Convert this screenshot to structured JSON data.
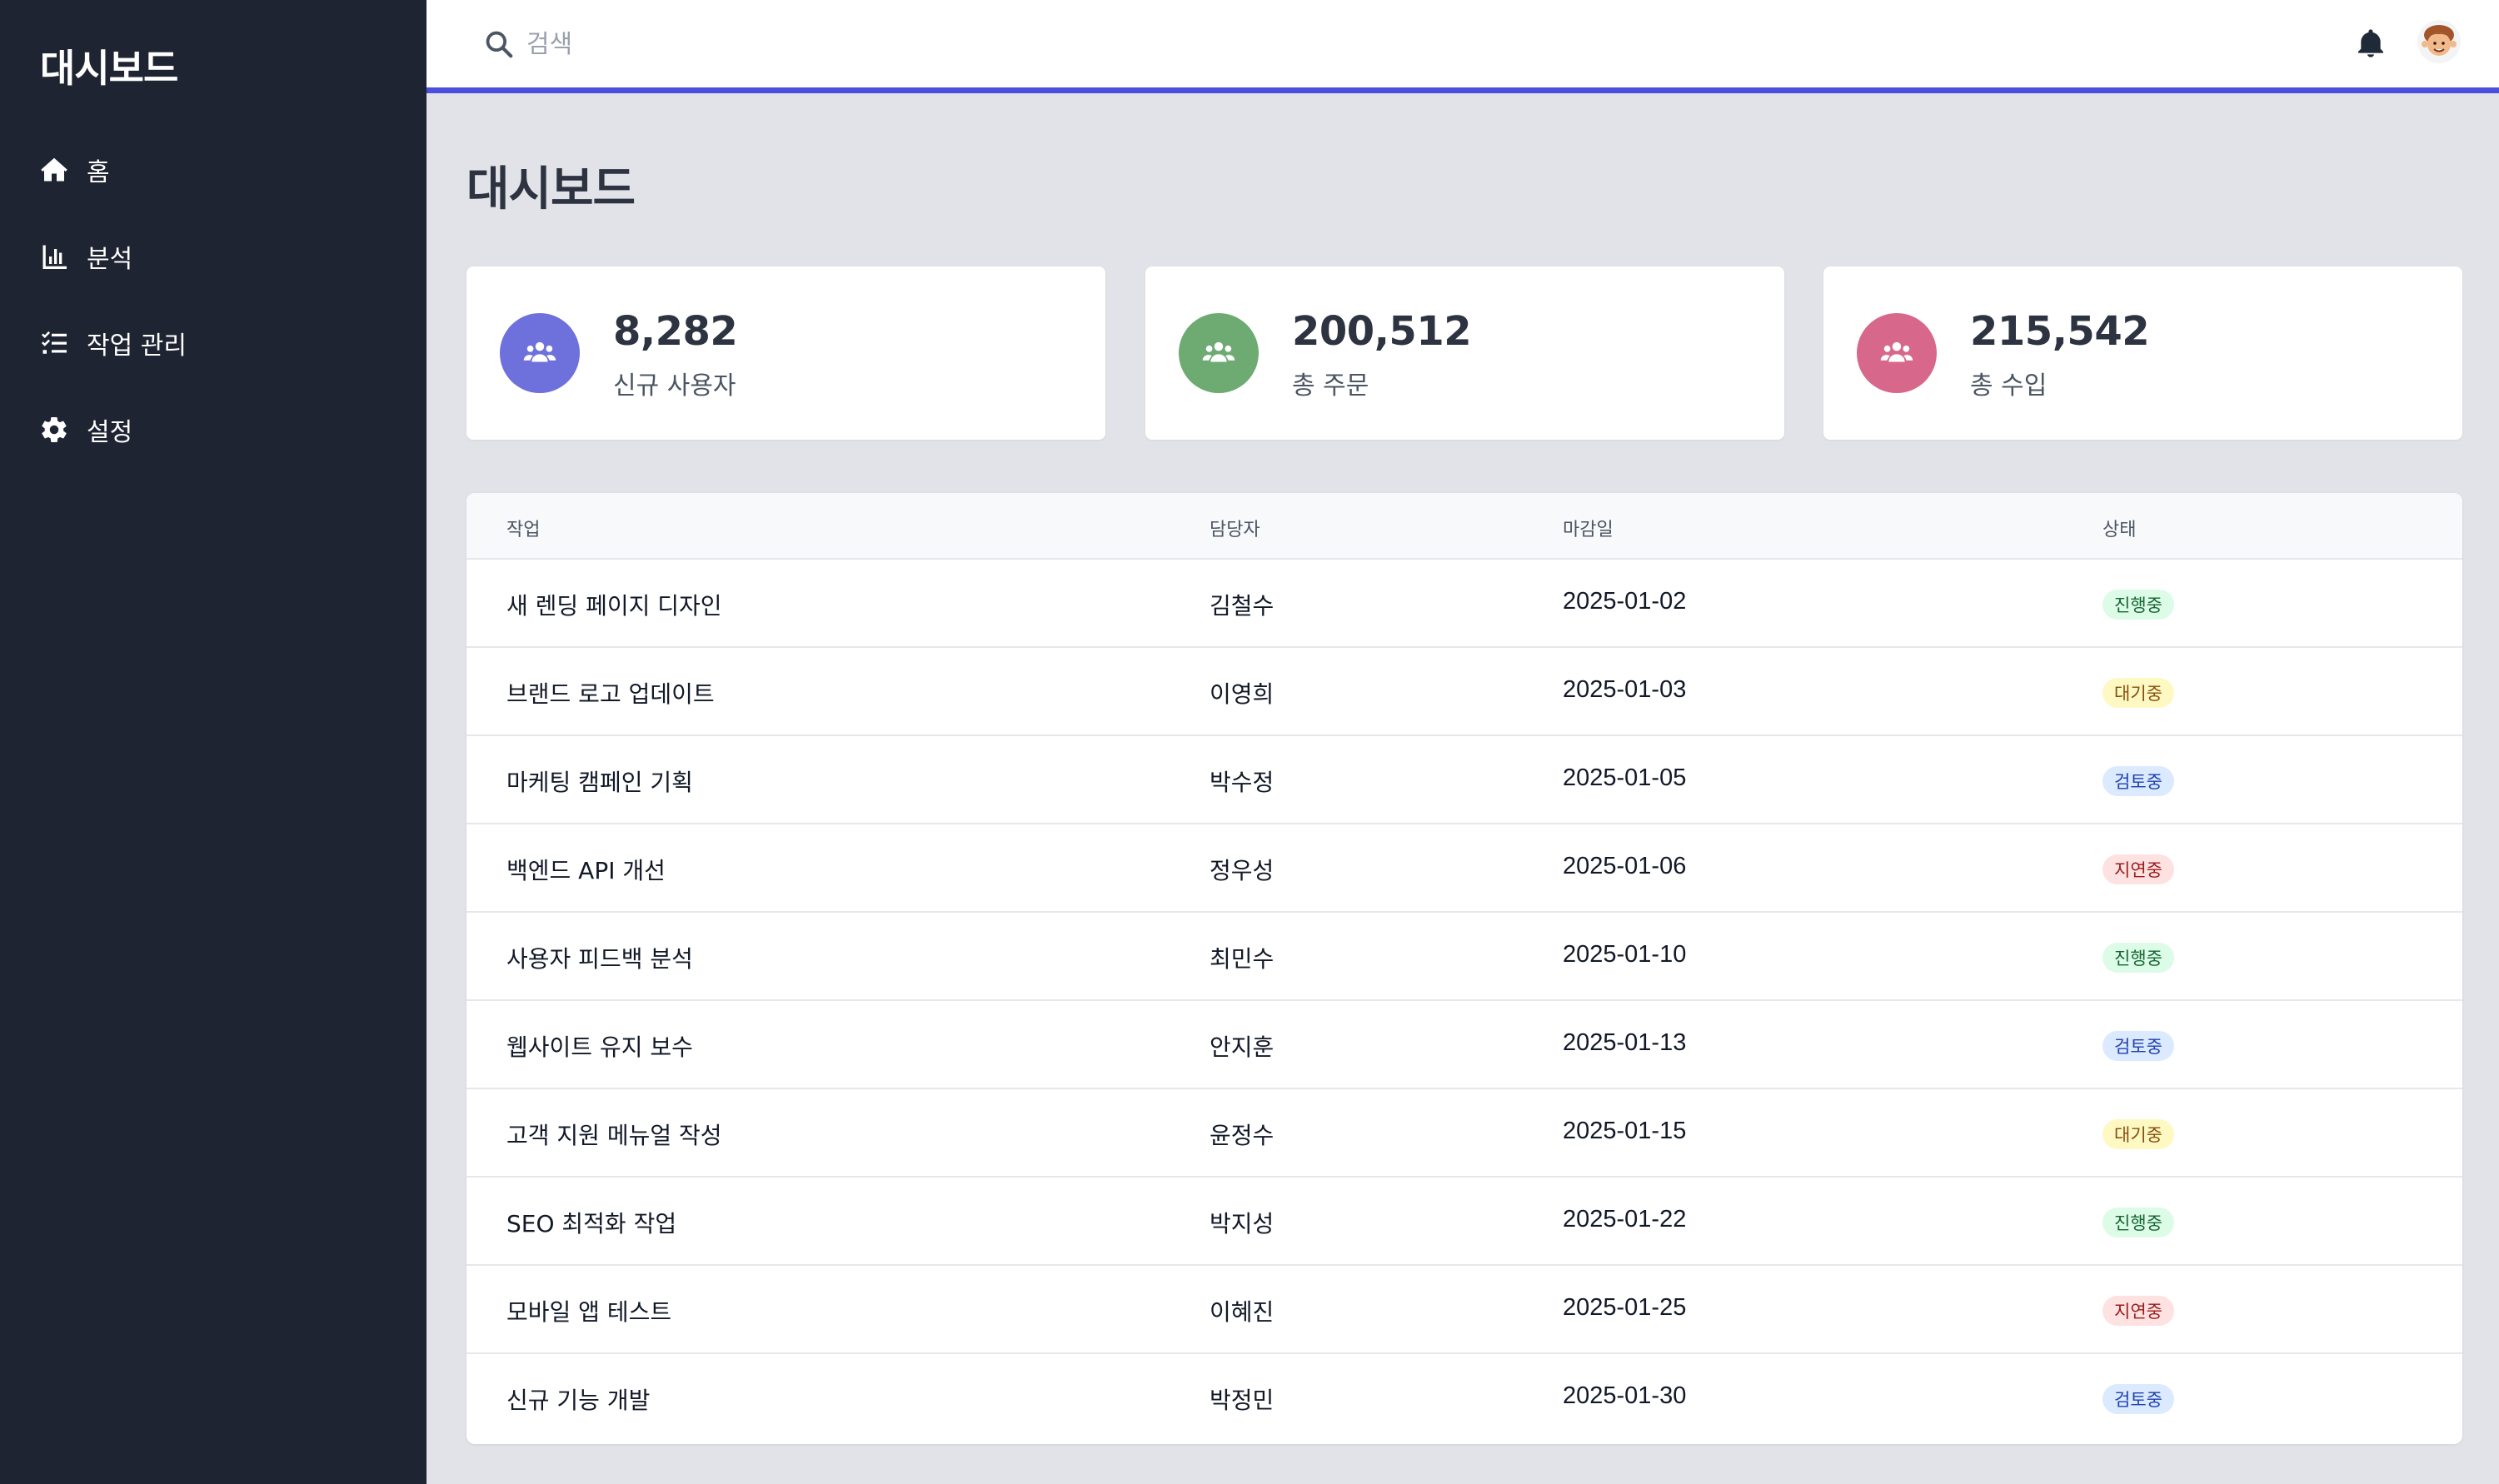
{
  "sidebar": {
    "brand": "대시보드",
    "items": [
      {
        "label": "홈",
        "icon": "home-icon"
      },
      {
        "label": "분석",
        "icon": "chart-icon"
      },
      {
        "label": "작업 관리",
        "icon": "tasks-icon"
      },
      {
        "label": "설정",
        "icon": "gear-icon"
      }
    ]
  },
  "topbar": {
    "search_placeholder": "검색",
    "accent_color": "#4b4fdb"
  },
  "page": {
    "title": "대시보드"
  },
  "stats": [
    {
      "value": "8,282",
      "label": "신규 사용자",
      "color": "#6e70dc",
      "icon": "users-icon"
    },
    {
      "value": "200,512",
      "label": "총 주문",
      "color": "#6eab72",
      "icon": "users-icon"
    },
    {
      "value": "215,542",
      "label": "총 수입",
      "color": "#d8688b",
      "icon": "users-icon"
    }
  ],
  "table": {
    "headers": {
      "task": "작업",
      "assignee": "담당자",
      "due": "마감일",
      "status": "상태"
    },
    "rows": [
      {
        "task": "새 렌딩 페이지 디자인",
        "assignee": "김철수",
        "due": "2025-01-02",
        "status": "진행중"
      },
      {
        "task": "브랜드 로고 업데이트",
        "assignee": "이영희",
        "due": "2025-01-03",
        "status": "대기중"
      },
      {
        "task": "마케팅 캠페인 기획",
        "assignee": "박수정",
        "due": "2025-01-05",
        "status": "검토중"
      },
      {
        "task": "백엔드 API 개선",
        "assignee": "정우성",
        "due": "2025-01-06",
        "status": "지연중"
      },
      {
        "task": "사용자 피드백 분석",
        "assignee": "최민수",
        "due": "2025-01-10",
        "status": "진행중"
      },
      {
        "task": "웹사이트 유지 보수",
        "assignee": "안지훈",
        "due": "2025-01-13",
        "status": "검토중"
      },
      {
        "task": "고객 지원 메뉴얼 작성",
        "assignee": "윤정수",
        "due": "2025-01-15",
        "status": "대기중"
      },
      {
        "task": "SEO 최적화 작업",
        "assignee": "박지성",
        "due": "2025-01-22",
        "status": "진행중"
      },
      {
        "task": "모바일 앱 테스트",
        "assignee": "이혜진",
        "due": "2025-01-25",
        "status": "지연중"
      },
      {
        "task": "신규 기능 개발",
        "assignee": "박정민",
        "due": "2025-01-30",
        "status": "검토중"
      }
    ],
    "status_colors": {
      "진행중": {
        "bg": "#dcfce7",
        "fg": "#166534"
      },
      "대기중": {
        "bg": "#fef9c3",
        "fg": "#854d0e"
      },
      "검토중": {
        "bg": "#dbeafe",
        "fg": "#1e40af"
      },
      "지연중": {
        "bg": "#fee2e2",
        "fg": "#991b1b"
      }
    }
  }
}
